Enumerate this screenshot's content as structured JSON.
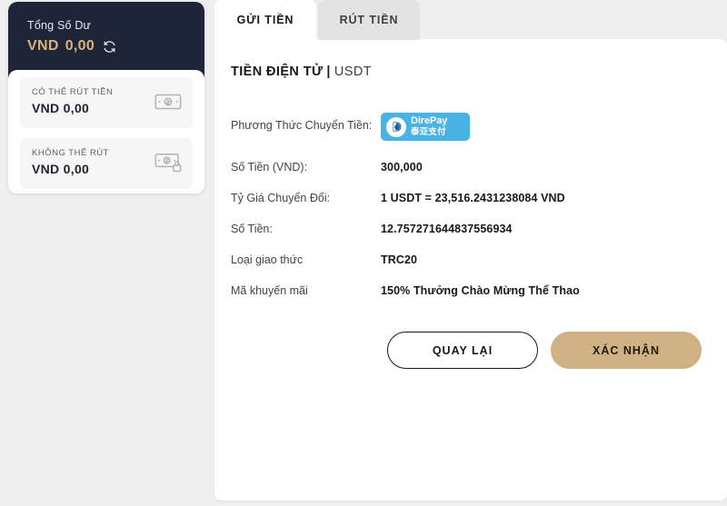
{
  "sidebar": {
    "balance": {
      "title": "Tổng Số Dư",
      "currency": "VND",
      "value": "0,00",
      "refresh_icon": "refresh-icon"
    },
    "subcards": [
      {
        "label": "CÓ THỂ RÚT TIỀN",
        "currency": "VND",
        "value": "0,00",
        "icon": "banknote-icon"
      },
      {
        "label": "KHÔNG THỂ RÚT",
        "currency": "VND",
        "value": "0,00",
        "icon": "banknote-lock-icon"
      }
    ]
  },
  "panel": {
    "tabs": [
      {
        "label": "GỬI TIỀN",
        "active": true
      },
      {
        "label": "RÚT TIỀN",
        "active": false
      }
    ],
    "section_title": {
      "main": "TIỀN ĐIỆN TỬ",
      "divider": "|",
      "sub": "USDT"
    },
    "rows": [
      {
        "label": "Phương Thức Chuyển Tiền:",
        "value": "",
        "type": "logo",
        "logo": {
          "name": "DirePay",
          "line1": "DirePay",
          "line2": "泰亚支付",
          "bg": "#49b3e5"
        }
      },
      {
        "label": "Số Tiền (VND):",
        "value": "300,000",
        "type": "text"
      },
      {
        "label": "Tỷ Giá Chuyển Đổi:",
        "value": "1 USDT = 23,516.2431238084 VND",
        "type": "text"
      },
      {
        "label": "Số Tiền:",
        "value": "12.757271644837556934",
        "type": "text"
      },
      {
        "label": "Loại giao thức",
        "value": "TRC20",
        "type": "text"
      },
      {
        "label": "Mã khuyến mãi",
        "value": "150% Thưởng Chào Mừng Thể Thao",
        "type": "text"
      }
    ],
    "actions": {
      "back_label": "QUAY LẠI",
      "confirm_label": "XÁC NHẬN"
    }
  },
  "colors": {
    "dark_navy": "#1e2539",
    "gold_text": "#d9b379",
    "gold_button": "#d0b183",
    "page_bg": "#efefef",
    "panel_bg": "#ffffff",
    "tab_inactive": "#e3e3e4",
    "logo_blue": "#49b3e5"
  }
}
